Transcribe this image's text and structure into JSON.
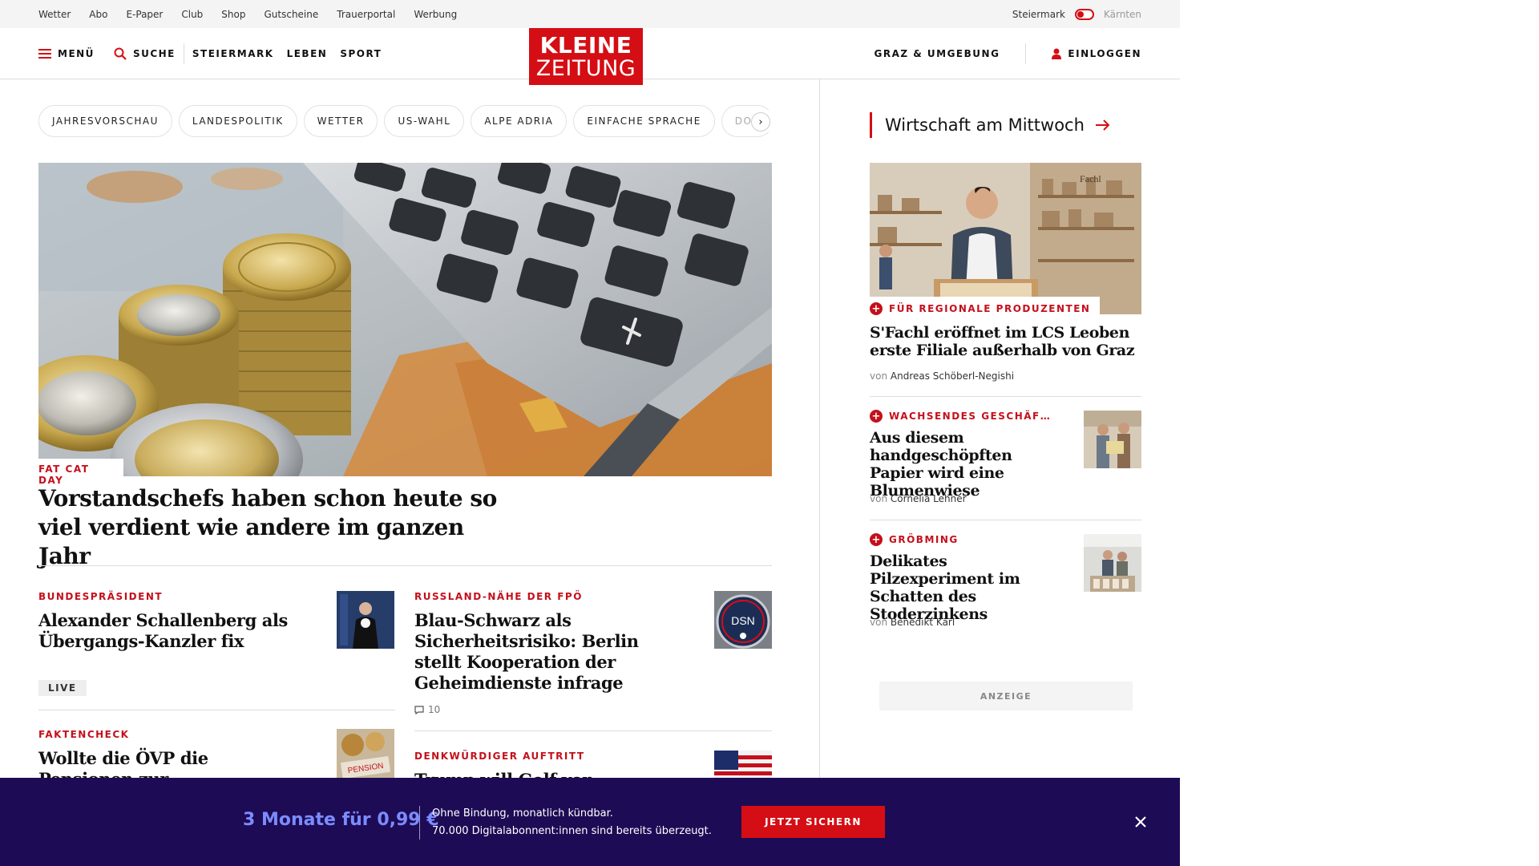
{
  "utility": {
    "links": [
      "Wetter",
      "Abo",
      "E-Paper",
      "Club",
      "Shop",
      "Gutscheine",
      "Trauerportal",
      "Werbung"
    ],
    "region_active": "Steiermark",
    "region_inactive": "Kärnten"
  },
  "nav": {
    "menu": "MENÜ",
    "search": "SUCHE",
    "sections": [
      "STEIERMARK",
      "LEBEN",
      "SPORT"
    ],
    "logo_line1": "KLEINE",
    "logo_line2": "ZEITUNG",
    "local": "GRAZ & UMGEBUNG",
    "login": "EINLOGGEN"
  },
  "tags": [
    "JAHRESVORSCHAU",
    "LANDESPOLITIK",
    "WETTER",
    "US-WAHL",
    "ALPE ADRIA",
    "EINFACHE SPRACHE",
    "DOS"
  ],
  "hero": {
    "kicker": "FAT CAT DAY",
    "title": "Vorstandschefs haben schon heute so viel verdient wie andere im ganzen Jahr"
  },
  "articles": [
    {
      "kicker": "BUNDESPRÄSIDENT",
      "title": "Alexander Schallenberg als Übergangs-Kanzler fix",
      "badge": "LIVE"
    },
    {
      "kicker": "RUSSLAND-NÄHE DER FPÖ",
      "title": "Blau-Schwarz als Sicherheitsrisiko: Berlin stellt Kooperation der Geheimdienste infrage",
      "comments": "10",
      "thumb_text": "DSN"
    },
    {
      "kicker": "FAKTENCHECK",
      "title": "Wollte die ÖVP die Pensionen zur Budgetsanierung kürzen?"
    },
    {
      "kicker": "DENKWÜRDIGER AUFTRITT",
      "title": "Trump will Golf von"
    }
  ],
  "sidebar": {
    "heading": "Wirtschaft am Mittwoch",
    "feature": {
      "kicker": "FÜR REGIONALE PRODUZENTEN",
      "title": "S'Fachl eröffnet im LCS Leoben erste Filiale außerhalb von Graz",
      "von": "von",
      "author": "Andreas Schöberl-Negishi",
      "sign": "Fachl"
    },
    "items": [
      {
        "kicker": "WACHSENDES GESCHÄF…",
        "title": "Aus diesem handgeschöpften Papier wird eine Blumenwiese",
        "von": "von",
        "author": "Cornelia Lehner"
      },
      {
        "kicker": "GRÖBMING",
        "title": "Delikates Pilzexperiment im Schatten des Stoderzinkens",
        "von": "von",
        "author": "Benedikt Karl"
      }
    ],
    "ad": "ANZEIGE"
  },
  "promo": {
    "price": "3 Monate für 0,99 €",
    "line1": "Ohne Bindung, monatlich kündbar.",
    "line2": "70.000 Digitalabonnent:innen sind bereits überzeugt.",
    "cta": "JETZT SICHERN"
  },
  "colors": {
    "brand_red": "#d40e14",
    "kicker_red": "#c4101c",
    "promo_bg": "#1e0b55",
    "promo_price": "#7b8cff"
  }
}
